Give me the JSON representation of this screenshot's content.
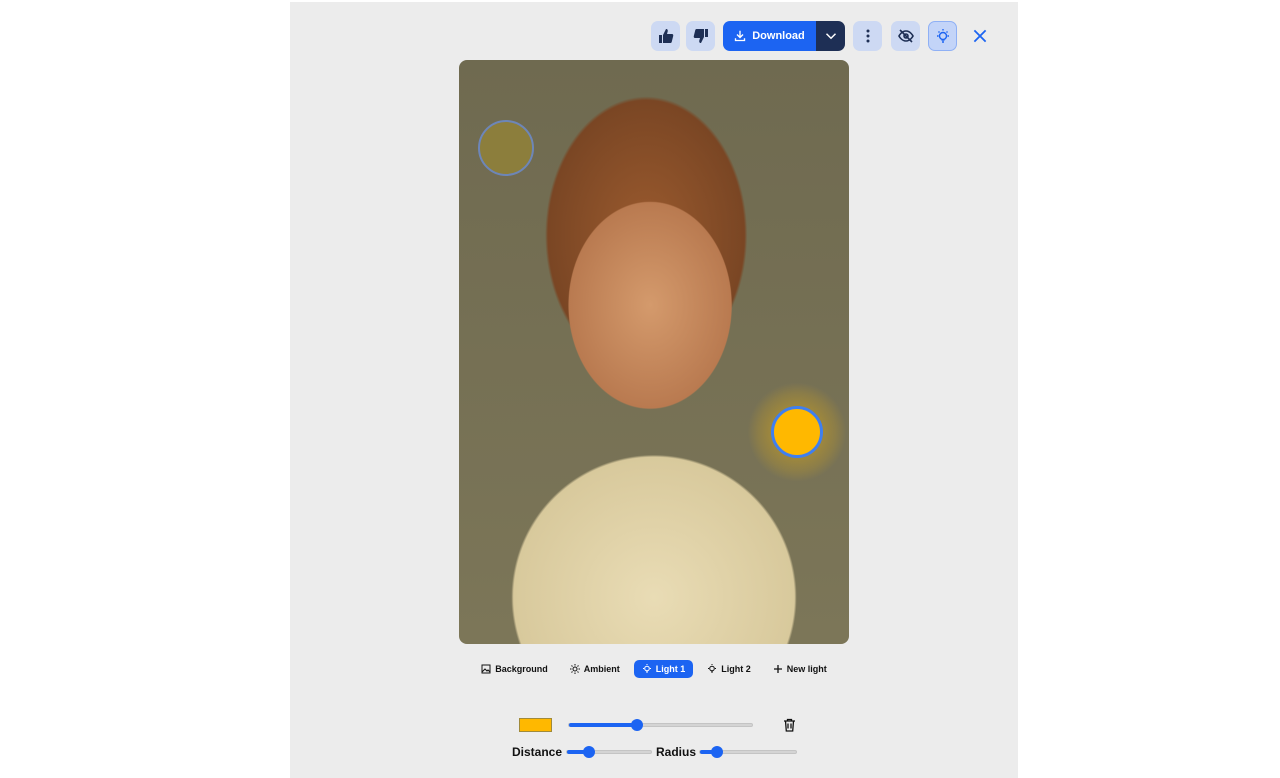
{
  "toolbar": {
    "download_label": "Download",
    "accent": "#1c64f2",
    "dark": "#1e2f55"
  },
  "tabs": [
    {
      "label": "Background",
      "icon": "image-icon"
    },
    {
      "label": "Ambient",
      "icon": "sun-icon"
    },
    {
      "label": "Light 1",
      "icon": "bulb-icon",
      "active": true
    },
    {
      "label": "Light 2",
      "icon": "bulb-icon"
    },
    {
      "label": "New light",
      "icon": "plus-icon"
    }
  ],
  "light_controls": {
    "color": "#ffb800",
    "intensity_percent": 37,
    "distance_label": "Distance",
    "distance_percent": 26,
    "radius_label": "Radius",
    "radius_percent": 18
  }
}
